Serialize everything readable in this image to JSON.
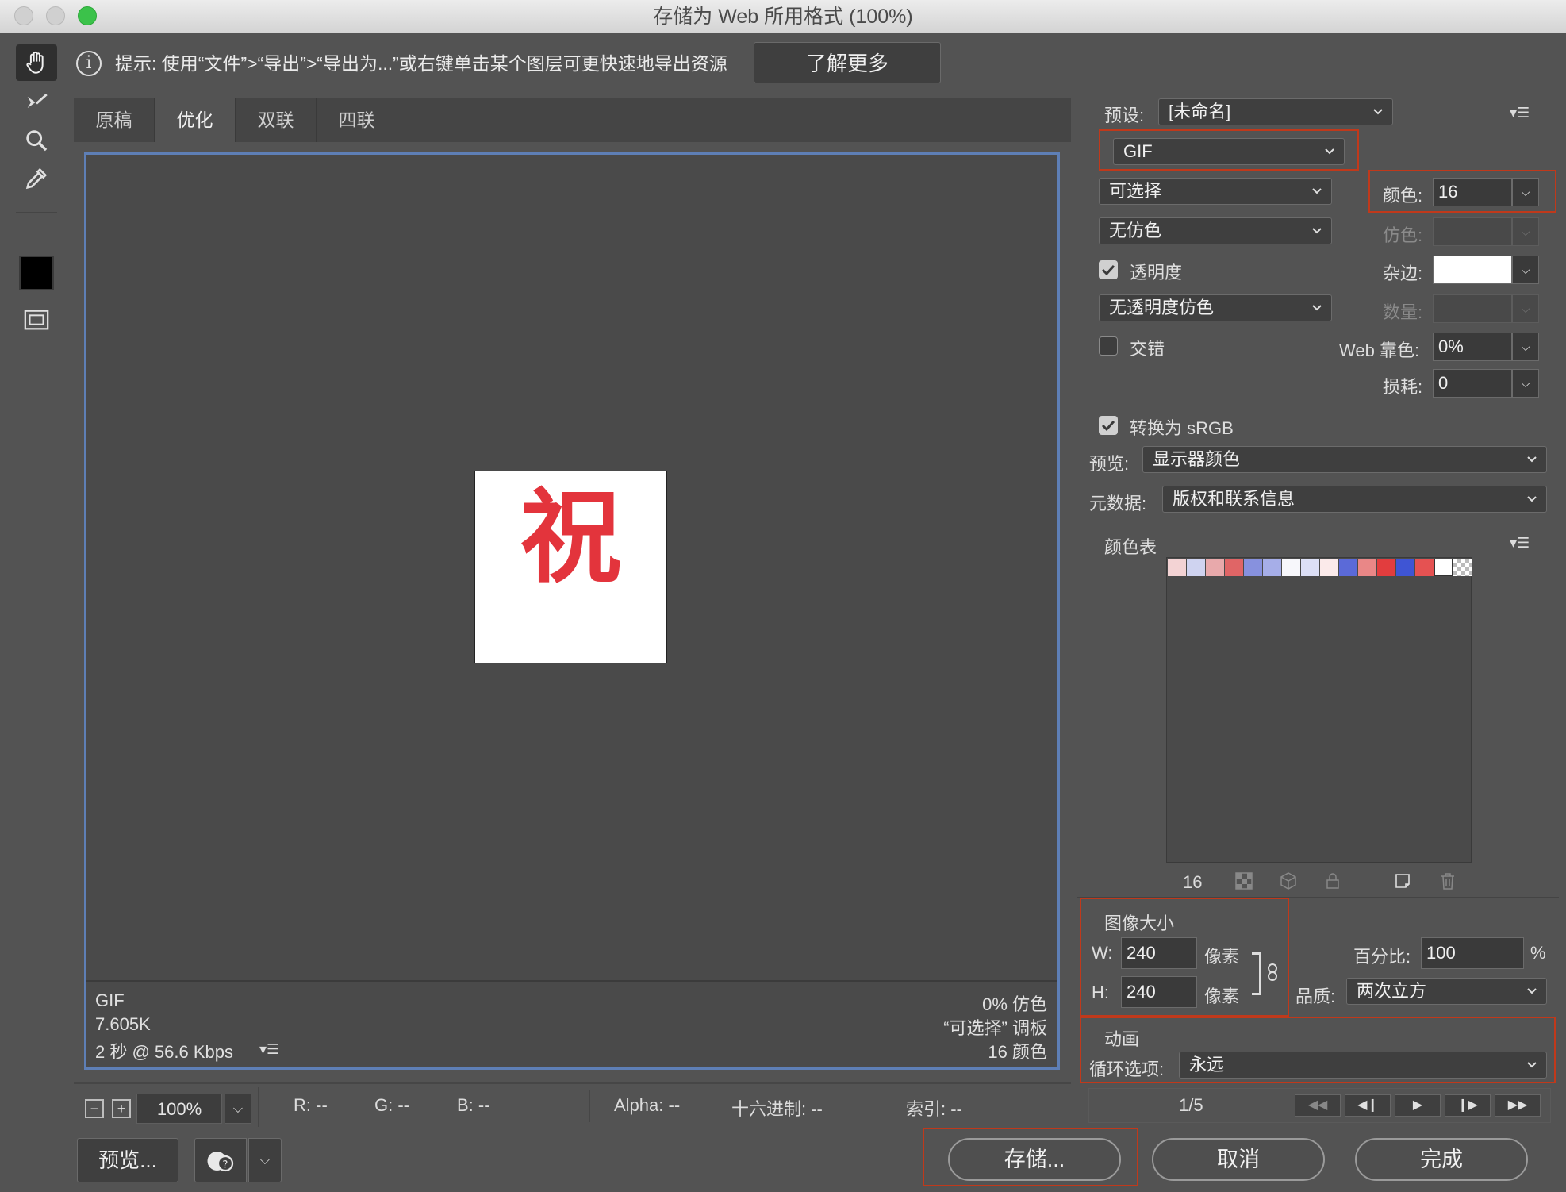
{
  "window": {
    "title": "存储为 Web 所用格式 (100%)"
  },
  "hint": {
    "text": "提示: 使用“文件”>“导出”>“导出为...”或右键单击某个图层可更快速地导出资源",
    "learn_more": "了解更多"
  },
  "tabs": [
    "原稿",
    "优化",
    "双联",
    "四联"
  ],
  "active_tab": "优化",
  "preview": {
    "character": "祝",
    "char_color": "#e3343c",
    "format": "GIF",
    "size": "7.605K",
    "speed": "2 秒 @ 56.6 Kbps",
    "dither": "0% 仿色",
    "palette": "“可选择” 调板",
    "colors": "16 颜色"
  },
  "status": {
    "zoom": "100%",
    "r": "R: --",
    "g": "G: --",
    "b": "B: --",
    "alpha": "Alpha: --",
    "hex": "十六进制: --",
    "index": "索引: --"
  },
  "buttons": {
    "preview": "预览...",
    "save": "存储...",
    "cancel": "取消",
    "done": "完成"
  },
  "settings": {
    "preset_label": "预设:",
    "preset_value": "[未命名]",
    "format": "GIF",
    "reduction": "可选择",
    "dither_algo": "无仿色",
    "transparency_label": "透明度",
    "transparency_checked": true,
    "trans_dither": "无透明度仿色",
    "interlace_label": "交错",
    "interlace_checked": false,
    "colors_label": "颜色:",
    "colors_value": "16",
    "dither_label": "仿色:",
    "matte_label": "杂边:",
    "amount_label": "数量:",
    "web_snap_label": "Web 靠色:",
    "web_snap_value": "0%",
    "lossy_label": "损耗:",
    "lossy_value": "0",
    "srgb_label": "转换为 sRGB",
    "srgb_checked": true,
    "preview_label": "预览:",
    "preview_value": "显示器颜色",
    "metadata_label": "元数据:",
    "metadata_value": "版权和联系信息"
  },
  "color_table": {
    "label": "颜色表",
    "count": "16",
    "swatches": [
      "#f3d3d4",
      "#cfd3f0",
      "#e8a9ab",
      "#e06566",
      "#8791de",
      "#a6aee8",
      "#f7f7fb",
      "#dde0f6",
      "#fbeaea",
      "#5b6ad8",
      "#e98787",
      "#e23d3e",
      "#3f55d4",
      "#e55252",
      "#ffffff",
      "#cccccc"
    ]
  },
  "image_size": {
    "label": "图像大小",
    "w_label": "W:",
    "w_value": "240",
    "h_label": "H:",
    "h_value": "240",
    "unit": "像素",
    "percent_label": "百分比:",
    "percent_value": "100",
    "percent_sign": "%",
    "quality_label": "品质:",
    "quality_value": "两次立方"
  },
  "animation": {
    "label": "动画",
    "loop_label": "循环选项:",
    "loop_value": "永远",
    "frame": "1/5"
  }
}
